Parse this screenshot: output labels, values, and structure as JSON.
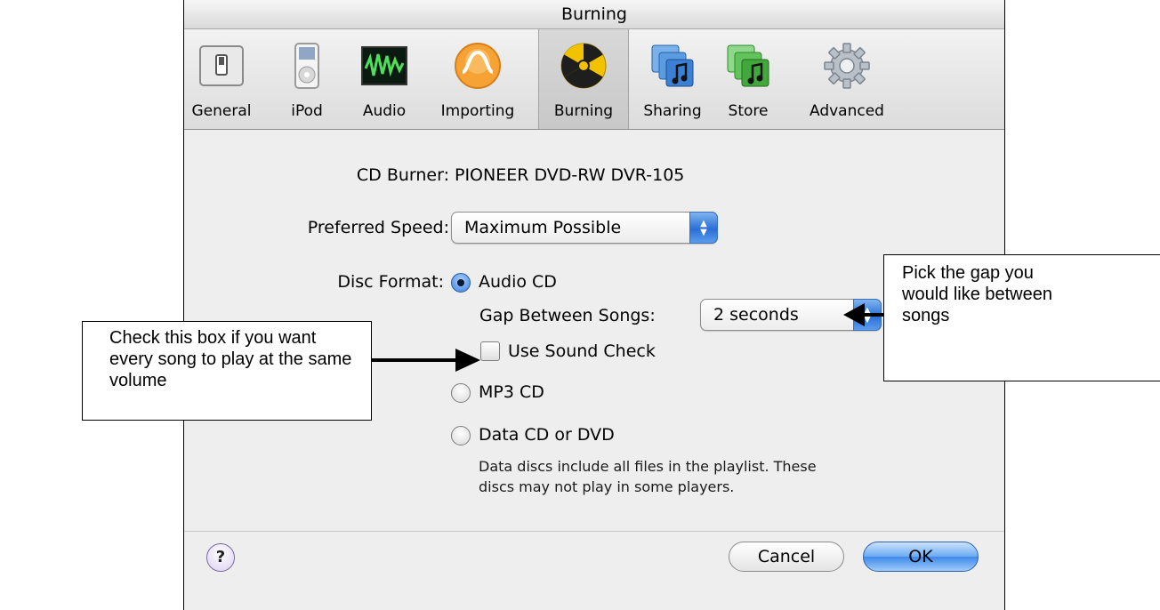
{
  "window": {
    "title": "Burning"
  },
  "toolbar": {
    "items": [
      {
        "label": "General",
        "icon": "general-switch-icon"
      },
      {
        "label": "iPod",
        "icon": "ipod-icon"
      },
      {
        "label": "Audio",
        "icon": "audio-waveform-icon"
      },
      {
        "label": "Importing",
        "icon": "importing-icon"
      },
      {
        "label": "Burning",
        "icon": "burning-radiation-icon",
        "selected": true
      },
      {
        "label": "Sharing",
        "icon": "sharing-icon"
      },
      {
        "label": "Store",
        "icon": "store-icon"
      },
      {
        "label": "Advanced",
        "icon": "gear-icon"
      }
    ]
  },
  "burner": {
    "label": "CD Burner:",
    "value": "PIONEER DVD-RW  DVR-105"
  },
  "speed": {
    "label": "Preferred Speed:",
    "value": "Maximum Possible"
  },
  "format": {
    "label": "Disc Format:",
    "audio_cd": "Audio CD",
    "gap_label": "Gap Between Songs:",
    "gap_value": "2 seconds",
    "sound_check": "Use Sound Check",
    "mp3_cd": "MP3 CD",
    "data_cd": "Data CD or DVD",
    "data_note_line1": "Data discs include all files in the playlist. These",
    "data_note_line2": "discs may not play in some players.",
    "selected": "Audio CD",
    "sound_check_checked": false
  },
  "footer": {
    "help": "?",
    "cancel": "Cancel",
    "ok": "OK"
  },
  "callouts": {
    "left": [
      "Check this box if you want",
      "every song to play at the same",
      "volume"
    ],
    "right": [
      "Pick the gap you",
      "would like between",
      "songs"
    ]
  },
  "colors": {
    "accent_blue": "#3e88ea",
    "burning_yellow": "#f2c200"
  }
}
